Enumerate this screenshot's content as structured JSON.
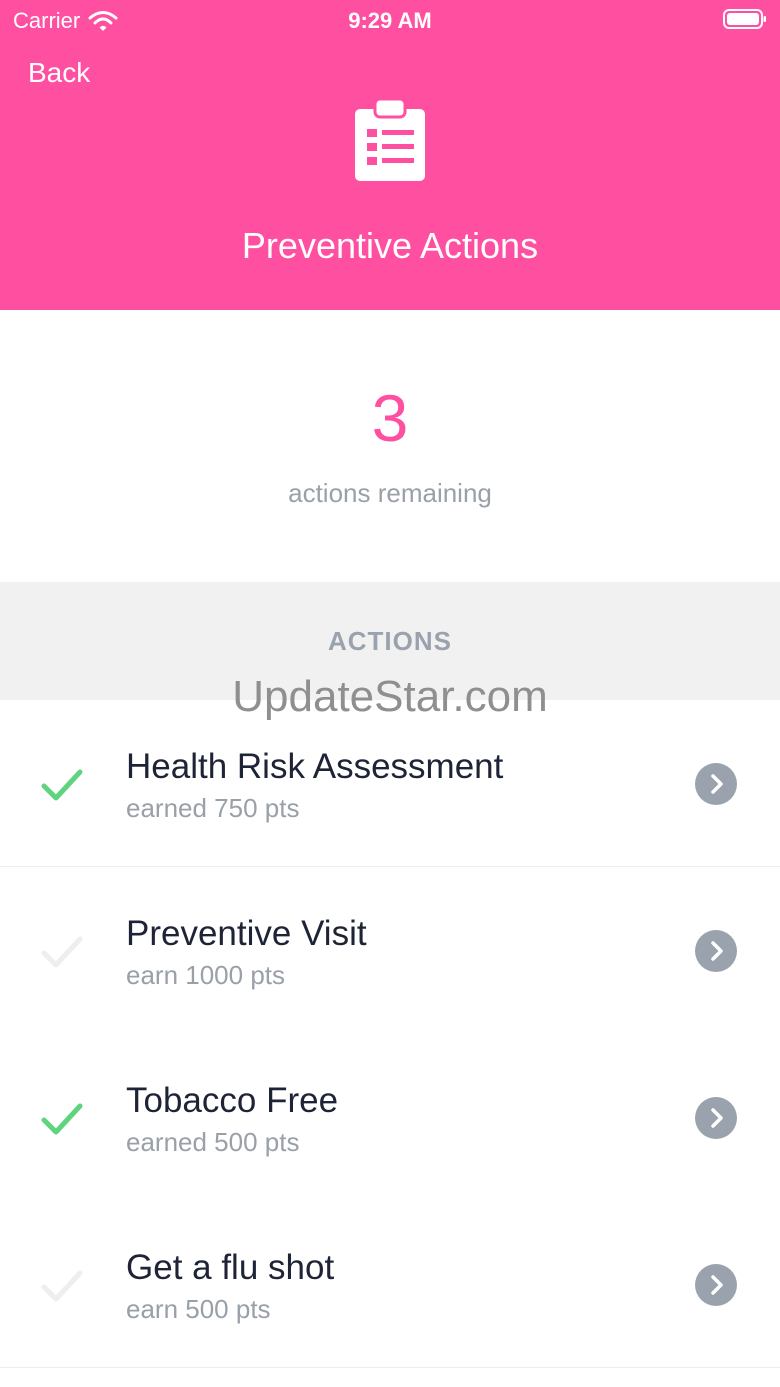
{
  "status_bar": {
    "carrier": "Carrier",
    "time": "9:29 AM",
    "wifi_icon": "wifi-icon",
    "battery_icon": "battery-icon"
  },
  "nav": {
    "back_label": "Back",
    "header_icon": "clipboard-list-icon",
    "title": "Preventive Actions",
    "accent_color": "#ff4fa0"
  },
  "summary": {
    "count": "3",
    "label": "actions remaining"
  },
  "section": {
    "title": "ACTIONS"
  },
  "watermark": "UpdateStar.com",
  "actions": [
    {
      "title": "Health Risk Assessment",
      "points": "earned 750 pts",
      "completed": true
    },
    {
      "title": "Preventive Visit",
      "points": "earn 1000 pts",
      "completed": false
    },
    {
      "title": "Tobacco Free",
      "points": "earned 500 pts",
      "completed": true
    },
    {
      "title": "Get a flu shot",
      "points": "earn 500 pts",
      "completed": false
    }
  ],
  "colors": {
    "check_done": "#5fd37e",
    "check_pending": "#eeeeee",
    "chevron_bg": "#9aa3ad"
  }
}
